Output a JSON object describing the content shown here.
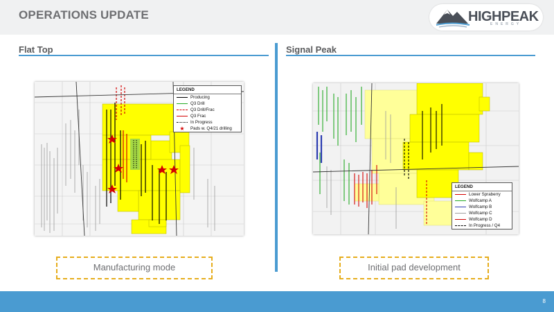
{
  "header": {
    "title": "OPERATIONS UPDATE",
    "logo": {
      "word": "HIGHPEAK",
      "sub": "ENERGY"
    }
  },
  "left": {
    "title": "Flat Top",
    "legend": {
      "heading": "LEGEND",
      "items": [
        {
          "label": "Producing",
          "color": "#000000",
          "style": "solid"
        },
        {
          "label": "Q3 Drill",
          "color": "#22aa22",
          "style": "solid"
        },
        {
          "label": "Q3 Drill/Frac",
          "color": "#d40000",
          "style": "dashed"
        },
        {
          "label": "Q3 Frac",
          "color": "#d40000",
          "style": "solid"
        },
        {
          "label": "In Progress",
          "color": "#000000",
          "style": "dotted"
        },
        {
          "label": "Pads w. Q4/21 drilling",
          "color": "#d40000",
          "style": "star"
        }
      ]
    },
    "callout": "Manufacturing mode"
  },
  "right": {
    "title": "Signal Peak",
    "legend": {
      "heading": "LEGEND",
      "items": [
        {
          "label": "Lower Spraberry",
          "color": "#d40000",
          "style": "solid"
        },
        {
          "label": "Wolfcamp A",
          "color": "#22aa22",
          "style": "solid"
        },
        {
          "label": "Wolfcamp B",
          "color": "#2a3bb0",
          "style": "solid"
        },
        {
          "label": "Wolfcamp C",
          "color": "#a0a0a0",
          "style": "solid"
        },
        {
          "label": "Wolfcamp D",
          "color": "#d40000",
          "style": "solid"
        },
        {
          "label": "In Progress / Q4",
          "color": "#000000",
          "style": "dashed"
        }
      ]
    },
    "callout": "Initial pad development"
  },
  "colors": {
    "accent": "#4a9bd1",
    "acreage": "#ffff00",
    "acreage_light": "#ffff99",
    "callout_border": "#e6ad1c"
  },
  "footer": {
    "page": "8"
  }
}
